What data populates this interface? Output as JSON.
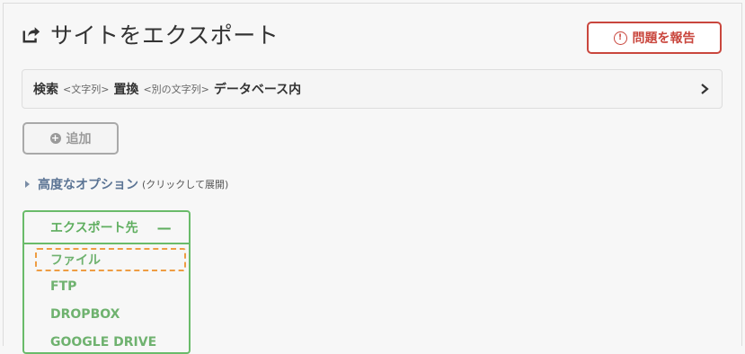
{
  "header": {
    "title": "サイトをエクスポート"
  },
  "report_button": {
    "label": "問題を報告"
  },
  "search_bar": {
    "search_label": "検索",
    "string_placeholder": "<文字列>",
    "replace_label": "置換",
    "other_string_placeholder": "<別の文字列>",
    "scope_label": "データベース内"
  },
  "add_button": {
    "label": "追加"
  },
  "advanced_options": {
    "label": "高度なオプション",
    "hint": "(クリックして展開)"
  },
  "destinations": {
    "title": "エクスポート先",
    "collapse_symbol": "—",
    "items": [
      "ファイル",
      "FTP",
      "DROPBOX",
      "GOOGLE DRIVE"
    ]
  },
  "colors": {
    "danger": "#c9463d",
    "success": "#6abb6a",
    "highlight": "#ee9d43",
    "link": "#5b7494"
  }
}
